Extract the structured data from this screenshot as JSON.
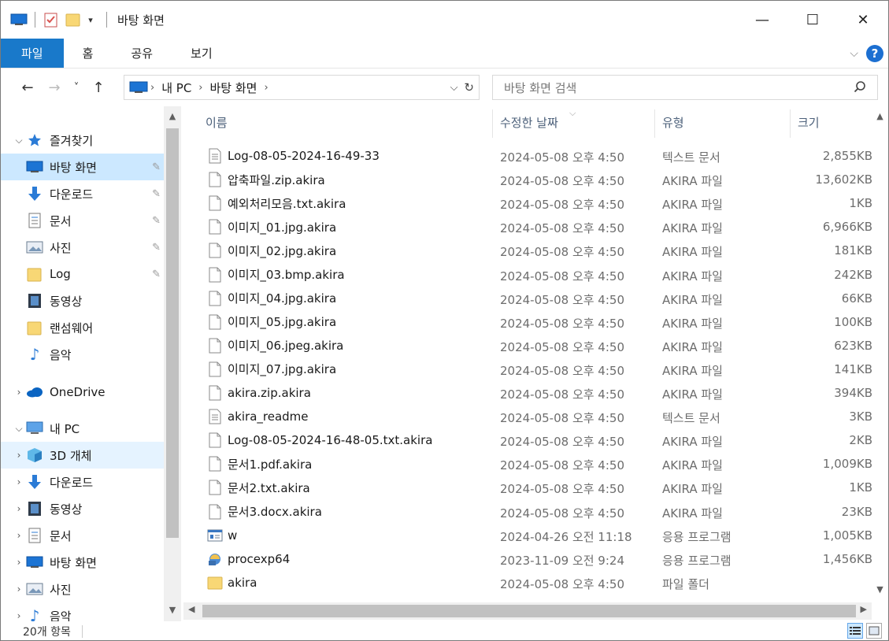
{
  "window": {
    "title": "바탕 화면",
    "minimize": "—",
    "maximize": "☐",
    "close": "✕"
  },
  "ribbon": {
    "tabs": [
      "파일",
      "홈",
      "공유",
      "보기"
    ],
    "help": "?"
  },
  "address": {
    "back": "←",
    "forward": "→",
    "recent": "˅",
    "up": "↑",
    "crumbs": [
      "내 PC",
      "바탕 화면"
    ],
    "refresh": "↻"
  },
  "search": {
    "placeholder": "바탕 화면 검색"
  },
  "sidebar": {
    "items": [
      {
        "label": "즐겨찾기",
        "icon": "star-icon"
      },
      {
        "label": "바탕 화면",
        "icon": "desktop-icon",
        "pinned": true
      },
      {
        "label": "다운로드",
        "icon": "download-icon",
        "pinned": true
      },
      {
        "label": "문서",
        "icon": "document-icon",
        "pinned": true
      },
      {
        "label": "사진",
        "icon": "picture-icon",
        "pinned": true
      },
      {
        "label": "Log",
        "icon": "folder-icon",
        "pinned": true
      },
      {
        "label": "동영상",
        "icon": "video-icon"
      },
      {
        "label": "랜섬웨어",
        "icon": "folder-icon"
      },
      {
        "label": "음악",
        "icon": "music-icon"
      },
      {
        "label": "OneDrive",
        "icon": "cloud-icon"
      },
      {
        "label": "내 PC",
        "icon": "pc-icon"
      },
      {
        "label": "3D 개체",
        "icon": "cube-icon"
      },
      {
        "label": "다운로드",
        "icon": "download-icon"
      },
      {
        "label": "동영상",
        "icon": "video-icon"
      },
      {
        "label": "문서",
        "icon": "document-icon"
      },
      {
        "label": "바탕 화면",
        "icon": "desktop-icon"
      },
      {
        "label": "사진",
        "icon": "picture-icon"
      },
      {
        "label": "음악",
        "icon": "music-icon"
      }
    ]
  },
  "columns": {
    "name": "이름",
    "date": "수정한 날짜",
    "type": "유형",
    "size": "크기"
  },
  "files": [
    {
      "name": "Log-08-05-2024-16-49-33",
      "date": "2024-05-08 오후 4:50",
      "type": "텍스트 문서",
      "size": "2,855KB",
      "icon": "text-file-icon"
    },
    {
      "name": "압축파일.zip.akira",
      "date": "2024-05-08 오후 4:50",
      "type": "AKIRA 파일",
      "size": "13,602KB",
      "icon": "blank-file-icon"
    },
    {
      "name": "예외처리모음.txt.akira",
      "date": "2024-05-08 오후 4:50",
      "type": "AKIRA 파일",
      "size": "1KB",
      "icon": "blank-file-icon"
    },
    {
      "name": "이미지_01.jpg.akira",
      "date": "2024-05-08 오후 4:50",
      "type": "AKIRA 파일",
      "size": "6,966KB",
      "icon": "blank-file-icon"
    },
    {
      "name": "이미지_02.jpg.akira",
      "date": "2024-05-08 오후 4:50",
      "type": "AKIRA 파일",
      "size": "181KB",
      "icon": "blank-file-icon"
    },
    {
      "name": "이미지_03.bmp.akira",
      "date": "2024-05-08 오후 4:50",
      "type": "AKIRA 파일",
      "size": "242KB",
      "icon": "blank-file-icon"
    },
    {
      "name": "이미지_04.jpg.akira",
      "date": "2024-05-08 오후 4:50",
      "type": "AKIRA 파일",
      "size": "66KB",
      "icon": "blank-file-icon"
    },
    {
      "name": "이미지_05.jpg.akira",
      "date": "2024-05-08 오후 4:50",
      "type": "AKIRA 파일",
      "size": "100KB",
      "icon": "blank-file-icon"
    },
    {
      "name": "이미지_06.jpeg.akira",
      "date": "2024-05-08 오후 4:50",
      "type": "AKIRA 파일",
      "size": "623KB",
      "icon": "blank-file-icon"
    },
    {
      "name": "이미지_07.jpg.akira",
      "date": "2024-05-08 오후 4:50",
      "type": "AKIRA 파일",
      "size": "141KB",
      "icon": "blank-file-icon"
    },
    {
      "name": "akira.zip.akira",
      "date": "2024-05-08 오후 4:50",
      "type": "AKIRA 파일",
      "size": "394KB",
      "icon": "blank-file-icon"
    },
    {
      "name": "akira_readme",
      "date": "2024-05-08 오후 4:50",
      "type": "텍스트 문서",
      "size": "3KB",
      "icon": "text-file-icon"
    },
    {
      "name": "Log-08-05-2024-16-48-05.txt.akira",
      "date": "2024-05-08 오후 4:50",
      "type": "AKIRA 파일",
      "size": "2KB",
      "icon": "blank-file-icon"
    },
    {
      "name": "문서1.pdf.akira",
      "date": "2024-05-08 오후 4:50",
      "type": "AKIRA 파일",
      "size": "1,009KB",
      "icon": "blank-file-icon"
    },
    {
      "name": "문서2.txt.akira",
      "date": "2024-05-08 오후 4:50",
      "type": "AKIRA 파일",
      "size": "1KB",
      "icon": "blank-file-icon"
    },
    {
      "name": "문서3.docx.akira",
      "date": "2024-05-08 오후 4:50",
      "type": "AKIRA 파일",
      "size": "23KB",
      "icon": "blank-file-icon"
    },
    {
      "name": "w",
      "date": "2024-04-26 오전 11:18",
      "type": "응용 프로그램",
      "size": "1,005KB",
      "icon": "app-window-icon"
    },
    {
      "name": "procexp64",
      "date": "2023-11-09 오전 9:24",
      "type": "응용 프로그램",
      "size": "1,456KB",
      "icon": "procexp-icon"
    },
    {
      "name": "akira",
      "date": "2024-05-08 오후 4:50",
      "type": "파일 폴더",
      "size": "",
      "icon": "folder-icon"
    }
  ],
  "status": {
    "count": "20개 항목"
  },
  "colors": {
    "accent": "#1979ca",
    "selected": "#cce8ff",
    "folder": "#f8d775"
  }
}
